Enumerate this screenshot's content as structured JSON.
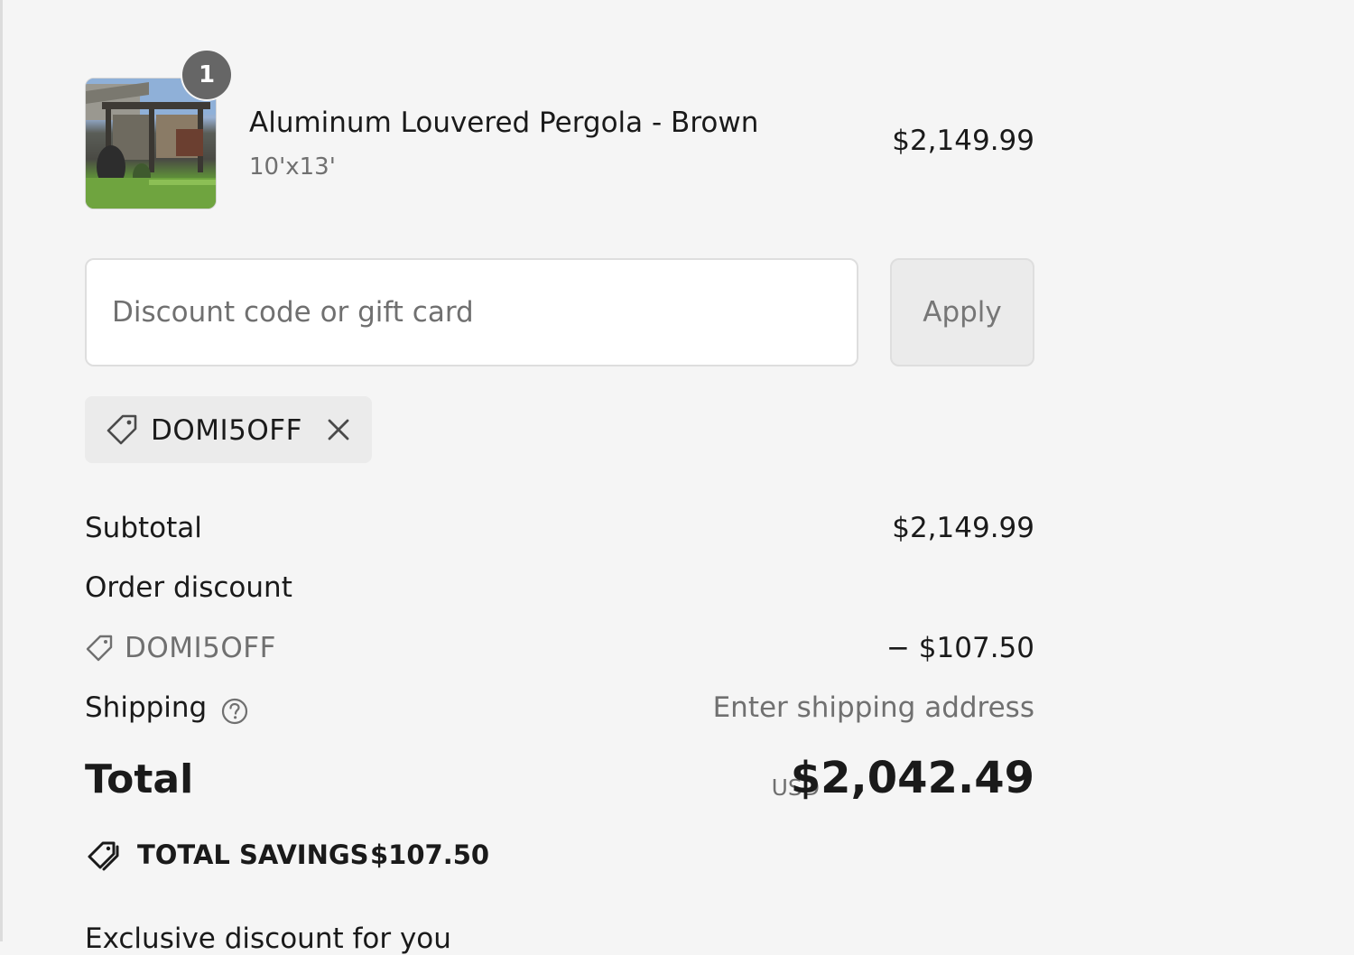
{
  "line_item": {
    "quantity": "1",
    "name": "Aluminum Louvered Pergola - Brown",
    "variant": "10'x13'",
    "price": "$2,149.99"
  },
  "discount": {
    "placeholder": "Discount code or gift card",
    "apply_label": "Apply",
    "applied_code": "DOMI5OFF"
  },
  "totals": {
    "subtotal_label": "Subtotal",
    "subtotal_value": "$2,149.99",
    "order_discount_label": "Order discount",
    "discount_code": "DOMI5OFF",
    "discount_amount": "− $107.50",
    "shipping_label": "Shipping",
    "shipping_value": "Enter shipping address",
    "total_label": "Total",
    "currency": "USD",
    "total_value": "$2,042.49",
    "savings_label": "TOTAL SAVINGS",
    "savings_value": "$107.50"
  },
  "footer": {
    "partial_text": "Exclusive discount for you"
  },
  "icons": {
    "tag": "tag-icon",
    "remove": "close-icon",
    "help": "question-circle-icon",
    "savings": "tags-icon"
  }
}
